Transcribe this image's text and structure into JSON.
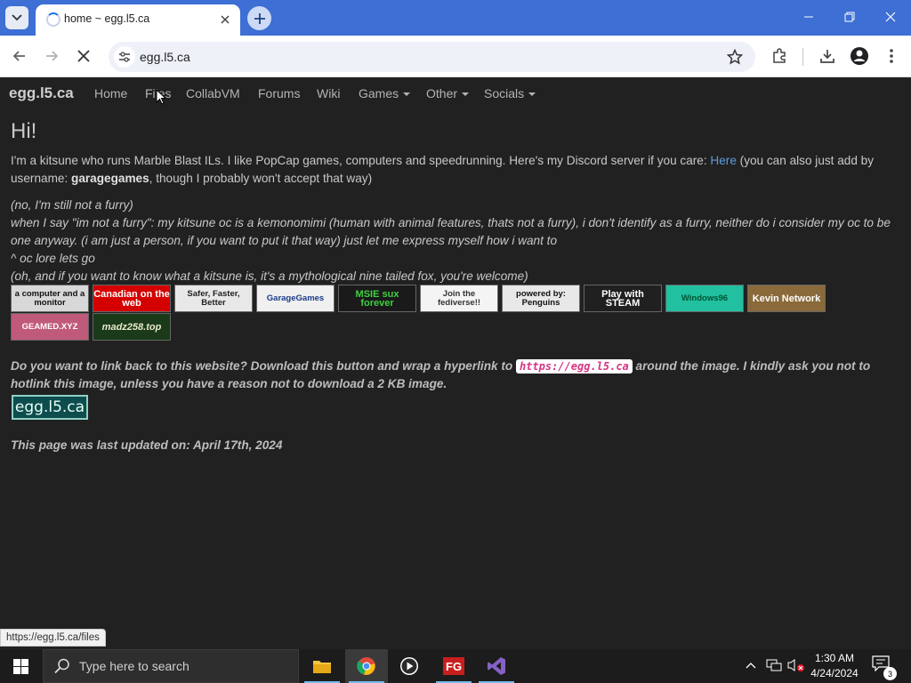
{
  "browser": {
    "tab_title": "home ~ egg.l5.ca",
    "url": "egg.l5.ca"
  },
  "site": {
    "brand": "egg.l5.ca",
    "nav": [
      {
        "label": "Home"
      },
      {
        "label": "Files"
      },
      {
        "label": "CollabVM"
      },
      {
        "label": "Forums"
      },
      {
        "label": "Wiki"
      },
      {
        "label": "Games",
        "dropdown": true
      },
      {
        "label": "Other",
        "dropdown": true
      },
      {
        "label": "Socials",
        "dropdown": true
      }
    ],
    "heading": "Hi!",
    "intro": {
      "pre": "I'm a kitsune who runs Marble Blast ILs. I like PopCap games, computers and speedrunning. Here's my Discord server if you care: ",
      "link": "Here",
      "mid": " (you can also just add by username: ",
      "username": "garagegames",
      "post": ", though I probably won't accept that way)"
    },
    "italic_lines": [
      "(no, I'm still not a furry)",
      "when I say \"im not a furry\": my kitsune oc is a kemonomimi (human with animal features, thats not a furry), i don't identify as a furry, neither do i consider my oc to be one anyway. (i am just a person, if you want to put it that way) just let me express myself how i want to",
      "^ oc lore lets go",
      "(oh, and if you want to know what a kitsune is, it's a mythological nine tailed fox, you're welcome)"
    ],
    "buttons_88x31": [
      {
        "text": "a computer and a monitor",
        "color": "#d8d8d8"
      },
      {
        "text": "Canadian on the web",
        "color": "#d40000"
      },
      {
        "text": "Safer, Faster, Better",
        "color": "#e8e8e8"
      },
      {
        "text": "GarageGames",
        "color": "#f0f0f0"
      },
      {
        "text": "MSIE sux forever",
        "color": "#1a1a1a"
      },
      {
        "text": "Join the fediverse!!",
        "color": "#f4f4f4"
      },
      {
        "text": "powered by: Penguins",
        "color": "#e8e8e8"
      },
      {
        "text": "Play with STEAM",
        "color": "#202020"
      },
      {
        "text": "Windows96",
        "color": "#20c0a0"
      },
      {
        "text": "Kevin Network",
        "color": "#5a3a1a"
      },
      {
        "text": "GEAMED.XYZ",
        "color": "#c05a7a"
      },
      {
        "text": "madz258.top",
        "color": "#1a3a1a"
      }
    ],
    "linkback": {
      "pre": "Do you want to link back to this website? Download this button and wrap a hyperlink to ",
      "code": "https://egg.l5.ca",
      "post": " around the image. I kindly ask you not to hotlink this image, unless you have a reason not to download a 2 KB image."
    },
    "egg_button": "egg.l5.ca",
    "updated": "This page was last updated on: April 17th, 2024"
  },
  "status_link": "https://egg.l5.ca/files",
  "taskbar": {
    "search_placeholder": "Type here to search",
    "time": "1:30 AM",
    "date": "4/24/2024",
    "notification_count": "3"
  }
}
